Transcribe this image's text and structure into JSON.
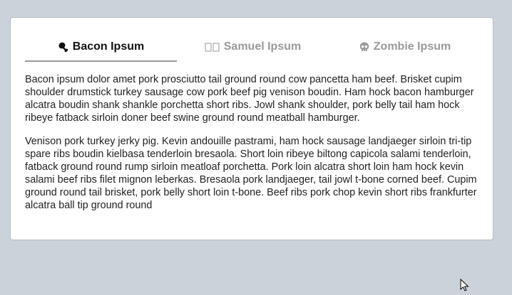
{
  "tabs": [
    {
      "label": "Bacon Ipsum",
      "icon": "drumstick-icon",
      "active": true
    },
    {
      "label": "Samuel Ipsum",
      "icon": "missing-glyph-icon",
      "active": false
    },
    {
      "label": "Zombie Ipsum",
      "icon": "skull-icon",
      "active": false
    }
  ],
  "content": {
    "paragraphs": [
      "Bacon ipsum dolor amet pork prosciutto tail ground round cow pancetta ham beef. Brisket cupim shoulder drumstick turkey sausage cow pork beef pig venison boudin. Ham hock bacon hamburger alcatra boudin shank shankle porchetta short ribs. Jowl shank shoulder, pork belly tail ham hock ribeye fatback sirloin doner beef swine ground round meatball hamburger.",
      "Venison pork turkey jerky pig. Kevin andouille pastrami, ham hock sausage landjaeger sirloin tri-tip spare ribs boudin kielbasa tenderloin bresaola. Short loin ribeye biltong capicola salami tenderloin, fatback ground round rump sirloin meatloaf porchetta. Pork loin alcatra short loin ham hock kevin salami beef ribs filet mignon leberkas. Bresaola pork landjaeger, tail jowl t-bone corned beef. Cupim ground round tail brisket, pork belly short loin t-bone. Beef ribs pork chop kevin short ribs frankfurter alcatra ball tip ground round"
    ]
  },
  "colors": {
    "background": "#ccd2d9",
    "card": "#ffffff",
    "active_tab_text": "#111111",
    "inactive_tab_text": "#9a9a9a",
    "body_text": "#222222"
  }
}
